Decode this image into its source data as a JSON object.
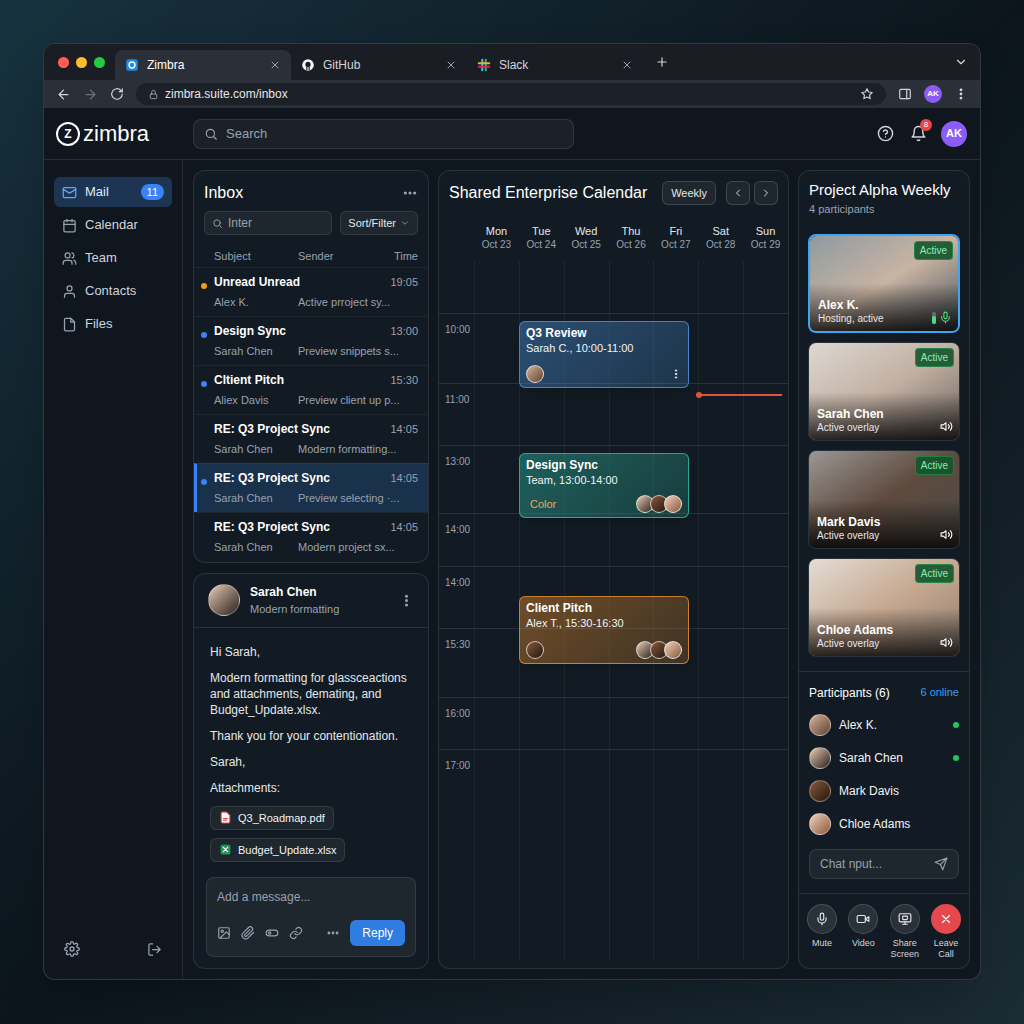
{
  "browser": {
    "tabs": [
      {
        "label": "Zimbra",
        "selected": true
      },
      {
        "label": "GitHub",
        "selected": false
      },
      {
        "label": "Slack",
        "selected": false
      }
    ],
    "url": "zimbra.suite.com/inbox",
    "profile": "AK"
  },
  "app": {
    "logo_mark": "Z",
    "logo_text": "zimbra",
    "search": {
      "placeholder": "Search"
    },
    "notifications": "8",
    "avatar": "AK"
  },
  "sidebar": {
    "items": [
      {
        "label": "Mail",
        "selected": true,
        "badge": "11"
      },
      {
        "label": "Calendar",
        "selected": false
      },
      {
        "label": "Team",
        "selected": false
      },
      {
        "label": "Contacts",
        "selected": false
      },
      {
        "label": "Files",
        "selected": false
      }
    ]
  },
  "inbox": {
    "title": "Inbox",
    "filter": {
      "placeholder": "Inter"
    },
    "sort": "Sort/Filter",
    "columns": [
      "Subject",
      "Sender",
      "Time"
    ],
    "rows": [
      {
        "subject": "Unread Unread",
        "sender": "Alex K.",
        "preview": "Active prroject sy...",
        "time": "19:05",
        "unread": true,
        "color": "#f59e0b",
        "selected": false
      },
      {
        "subject": "Design Sync",
        "sender": "Sarah Chen",
        "preview": "Preview snippets s...",
        "time": "13:00",
        "unread": true,
        "color": "#3b82f6",
        "selected": false
      },
      {
        "subject": "Cltient Pitch",
        "sender": "Aliex Davis",
        "preview": "Preview client up p...",
        "time": "15:30",
        "unread": true,
        "color": "#3b82f6",
        "selected": false
      },
      {
        "subject": "RE: Q3 Project Sync",
        "sender": "Sarah Chen",
        "preview": "Modern formatting...",
        "time": "14:05",
        "unread": false,
        "selected": false
      },
      {
        "subject": "RE: Q3 Project Sync",
        "sender": "Sarah Chen",
        "preview": "Preview selecting ·...",
        "time": "14:05",
        "unread": true,
        "color": "#3b82f6",
        "selected": true
      },
      {
        "subject": "RE: Q3 Project Sync",
        "sender": "Sarah Chen",
        "preview": "Modern project sx...",
        "time": "14:05",
        "unread": false,
        "selected": false
      }
    ]
  },
  "message": {
    "sender": "Sarah Chen",
    "subtitle": "Modern formatting",
    "body": [
      "Hi Sarah,",
      "Modern formatting for glassceactions and attachments, demating, and Budget_Update.xlsx.",
      "Thank you for your contentionation.",
      "Sarah,"
    ],
    "attachments_label": "Attachments:",
    "attachments": [
      {
        "name": "Q3_Roadmap.pdf",
        "kind": "pdf"
      },
      {
        "name": "Budget_Update.xlsx",
        "kind": "xlsx"
      }
    ],
    "compose": {
      "placeholder": "Add a message...",
      "send": "Reply"
    }
  },
  "calendar": {
    "title": "Shared Enterprise Calendar",
    "view": "Weekly",
    "days": [
      {
        "name": "Mon",
        "date": "Oct 23"
      },
      {
        "name": "Tue",
        "date": "Oct 24"
      },
      {
        "name": "Wed",
        "date": "Oct 25"
      },
      {
        "name": "Thu",
        "date": "Oct 26"
      },
      {
        "name": "Fri",
        "date": "Oct 27"
      },
      {
        "name": "Sat",
        "date": "Oct 28"
      },
      {
        "name": "Sun",
        "date": "Oct 29"
      }
    ],
    "times": [
      "10:00",
      "11:00",
      "13:00",
      "14:00",
      "14:00",
      "15:30",
      "16:00",
      "17:00"
    ],
    "events": [
      {
        "title": "Q3 Review",
        "detail": "Sarah C., 10:00-11:00",
        "color": "#4a8fd6",
        "host_avatar": true,
        "avatars": 0,
        "menu": true
      },
      {
        "title": "Design Sync",
        "detail": "Team, 13:00-14:00",
        "color": "#2fb5a0",
        "host_avatar": false,
        "tag": "Color",
        "avatars": 3,
        "menu": false
      },
      {
        "title": "Client Pitch",
        "detail": "Alex T., 15:30-16:30",
        "color": "#e08a2e",
        "host_avatar": true,
        "avatars": 3,
        "menu": false
      }
    ],
    "now_marker": true
  },
  "call": {
    "title": "Project Alpha Weekly",
    "subtitle": "4 participants",
    "tiles": [
      {
        "name": "Alex K.",
        "status": "Hosting, active",
        "badge": "Active",
        "selected": true,
        "kind": "mic",
        "level": 0.6
      },
      {
        "name": "Sarah Chen",
        "status": "Active overlay",
        "badge": "Active",
        "selected": false,
        "kind": "speaker"
      },
      {
        "name": "Mark Davis",
        "status": "Active overlay",
        "badge": "Active",
        "selected": false,
        "kind": "speaker"
      },
      {
        "name": "Chloe Adams",
        "status": "Active overlay",
        "badge": "Active",
        "selected": false,
        "kind": "speaker"
      }
    ],
    "participants": {
      "title": "Participants (6)",
      "online": "6 online",
      "list": [
        {
          "name": "Alex K.",
          "online": true
        },
        {
          "name": "Sarah Chen",
          "online": true
        },
        {
          "name": "Mark Davis",
          "online": false
        },
        {
          "name": "Chloe Adams",
          "online": false
        }
      ]
    },
    "chat": {
      "placeholder": "Chat nput..."
    },
    "controls": [
      {
        "label": "Mute",
        "danger": false
      },
      {
        "label": "Video",
        "danger": false
      },
      {
        "label": "Share Screen",
        "danger": false
      },
      {
        "label": "Leave Call",
        "danger": true
      }
    ]
  }
}
